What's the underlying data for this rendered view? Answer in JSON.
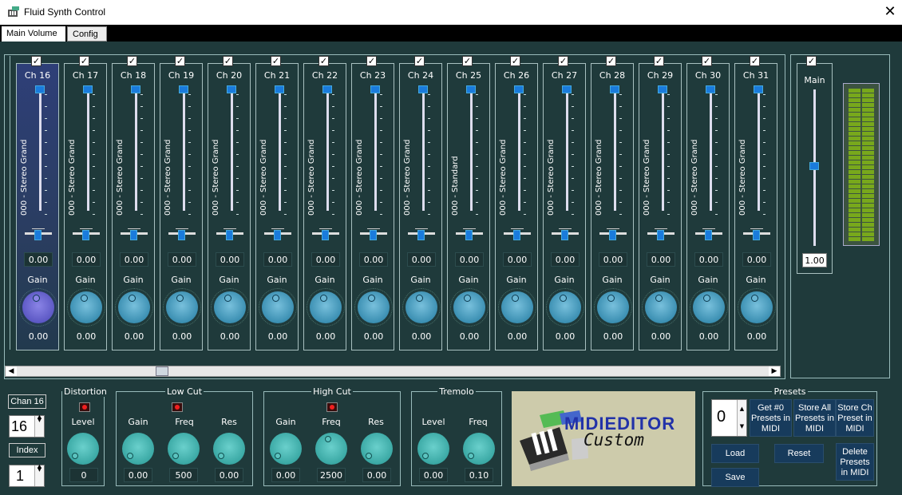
{
  "window": {
    "title": "Fluid Synth Control",
    "close_glyph": "✕"
  },
  "tabs": [
    {
      "label": "Main Volume"
    },
    {
      "label": "Config"
    }
  ],
  "channels": [
    {
      "label": "Ch 16",
      "instrument": "000 - Stereo Grand",
      "pan": "0.00",
      "gain_label": "Gain",
      "gain": "0.00"
    },
    {
      "label": "Ch 17",
      "instrument": "000 - Stereo Grand",
      "pan": "0.00",
      "gain_label": "Gain",
      "gain": "0.00"
    },
    {
      "label": "Ch 18",
      "instrument": "000 - Stereo Grand",
      "pan": "0.00",
      "gain_label": "Gain",
      "gain": "0.00"
    },
    {
      "label": "Ch 19",
      "instrument": "000 - Stereo Grand",
      "pan": "0.00",
      "gain_label": "Gain",
      "gain": "0.00"
    },
    {
      "label": "Ch 20",
      "instrument": "000 - Stereo Grand",
      "pan": "0.00",
      "gain_label": "Gain",
      "gain": "0.00"
    },
    {
      "label": "Ch 21",
      "instrument": "000 - Stereo Grand",
      "pan": "0.00",
      "gain_label": "Gain",
      "gain": "0.00"
    },
    {
      "label": "Ch 22",
      "instrument": "000 - Stereo Grand",
      "pan": "0.00",
      "gain_label": "Gain",
      "gain": "0.00"
    },
    {
      "label": "Ch 23",
      "instrument": "000 - Stereo Grand",
      "pan": "0.00",
      "gain_label": "Gain",
      "gain": "0.00"
    },
    {
      "label": "Ch 24",
      "instrument": "000 - Stereo Grand",
      "pan": "0.00",
      "gain_label": "Gain",
      "gain": "0.00"
    },
    {
      "label": "Ch 25",
      "instrument": "000 - Standard",
      "pan": "0.00",
      "gain_label": "Gain",
      "gain": "0.00"
    },
    {
      "label": "Ch 26",
      "instrument": "000 - Stereo Grand",
      "pan": "0.00",
      "gain_label": "Gain",
      "gain": "0.00"
    },
    {
      "label": "Ch 27",
      "instrument": "000 - Stereo Grand",
      "pan": "0.00",
      "gain_label": "Gain",
      "gain": "0.00"
    },
    {
      "label": "Ch 28",
      "instrument": "000 - Stereo Grand",
      "pan": "0.00",
      "gain_label": "Gain",
      "gain": "0.00"
    },
    {
      "label": "Ch 29",
      "instrument": "000 - Stereo Grand",
      "pan": "0.00",
      "gain_label": "Gain",
      "gain": "0.00"
    },
    {
      "label": "Ch 30",
      "instrument": "000 - Stereo Grand",
      "pan": "0.00",
      "gain_label": "Gain",
      "gain": "0.00"
    },
    {
      "label": "Ch 31",
      "instrument": "000 - Stereo Grand",
      "pan": "0.00",
      "gain_label": "Gain",
      "gain": "0.00"
    }
  ],
  "main": {
    "label": "Main",
    "value": "1.00",
    "meter_segments": 32
  },
  "channel_select": {
    "label": "Chan 16",
    "value": "16",
    "index_label": "Index",
    "index_value": "1"
  },
  "distortion": {
    "title": "Distortion",
    "level_label": "Level",
    "level": "0"
  },
  "lowcut": {
    "title": "Low Cut",
    "gain_label": "Gain",
    "freq_label": "Freq",
    "res_label": "Res",
    "gain": "0.00",
    "freq": "500",
    "res": "0.00"
  },
  "highcut": {
    "title": "High Cut",
    "gain_label": "Gain",
    "freq_label": "Freq",
    "res_label": "Res",
    "gain": "0.00",
    "freq": "2500",
    "res": "0.00"
  },
  "tremolo": {
    "title": "Tremolo",
    "level_label": "Level",
    "freq_label": "Freq",
    "level": "0.00",
    "freq": "0.10"
  },
  "logo": {
    "line1": "MIDIEDITOR",
    "line2": "Custom"
  },
  "presets": {
    "title": "Presets",
    "value": "0",
    "get": "Get #0 Presets in MIDI",
    "store_all": "Store All Presets in MIDI",
    "store_ch": "Store Ch Preset in MIDI",
    "load": "Load",
    "reset": "Reset",
    "save": "Save",
    "delete": "Delete Presets in MIDI"
  },
  "colors": {
    "background": "#1f3a3b",
    "accent": "#1a7bdc",
    "knob": "#3b8fb2",
    "selected_channel": "#2e3f78"
  }
}
